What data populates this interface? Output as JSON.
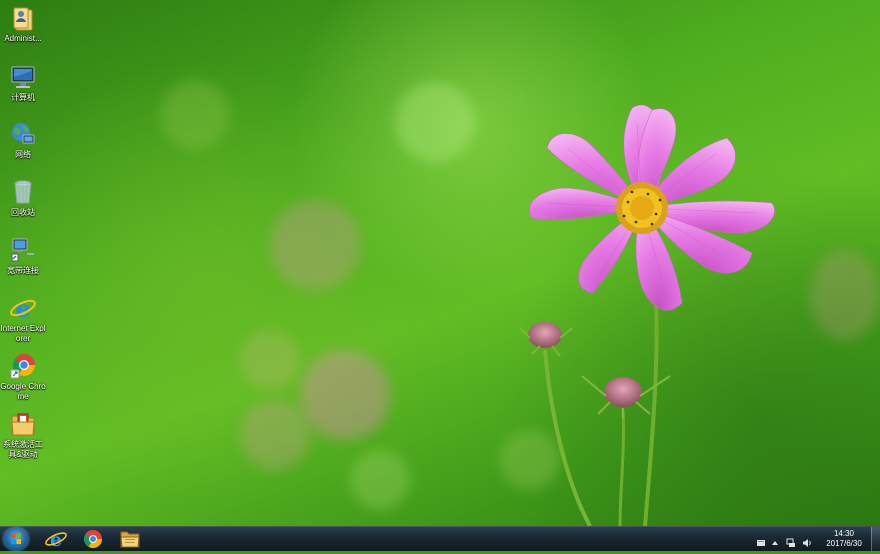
{
  "desktop": {
    "icons": [
      {
        "label": "Administ...",
        "icon": "user-folder-icon"
      },
      {
        "label": "计算机",
        "icon": "computer-icon"
      },
      {
        "label": "网络",
        "icon": "network-icon"
      },
      {
        "label": "回收站",
        "icon": "recycle-bin-icon"
      },
      {
        "label": "宽带连接",
        "icon": "broadband-connection-icon"
      },
      {
        "label": "Internet Explorer",
        "icon": "internet-explorer-icon"
      },
      {
        "label": "Google Chrome",
        "icon": "chrome-icon"
      },
      {
        "label": "系统激活工具&驱动",
        "icon": "folder-icon"
      }
    ]
  },
  "taskbar": {
    "start": "start-button",
    "pinned": [
      {
        "name": "internet-explorer",
        "icon": "internet-explorer-icon"
      },
      {
        "name": "google-chrome",
        "icon": "chrome-icon"
      },
      {
        "name": "file-explorer",
        "icon": "folder-icon"
      }
    ],
    "tray": {
      "icons": [
        "action-center-icon",
        "show-hidden-icons-icon",
        "network-status-icon",
        "volume-icon"
      ],
      "time": "14:30",
      "date": "2017/6/30"
    }
  },
  "colors": {
    "wallpaper_green": "#4fae1f",
    "petal_pink": "#e77de6",
    "taskbar_dark": "#1a2a35"
  }
}
